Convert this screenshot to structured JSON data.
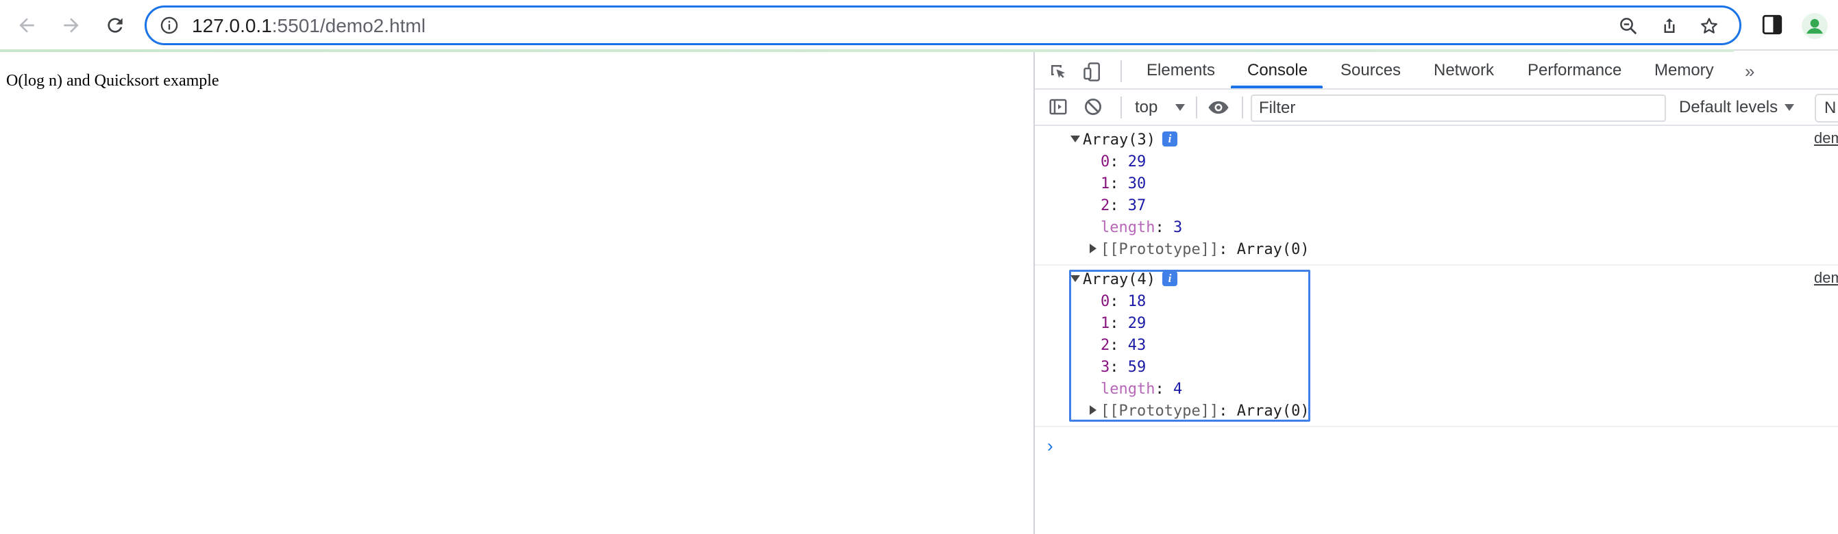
{
  "browser": {
    "url_host": "127.0.0.1",
    "url_rest": ":5501/demo2.html"
  },
  "page": {
    "text": "O(log n) and Quicksort example"
  },
  "devtools": {
    "tabs": [
      {
        "label": "Elements",
        "active": false
      },
      {
        "label": "Console",
        "active": true
      },
      {
        "label": "Sources",
        "active": false
      },
      {
        "label": "Network",
        "active": false
      },
      {
        "label": "Performance",
        "active": false
      },
      {
        "label": "Memory",
        "active": false
      }
    ],
    "more_tabs_glyph": "»",
    "context": "top",
    "filter_placeholder": "Filter",
    "levels": "Default levels",
    "cut_button": "N",
    "accent": "#1a73e8"
  },
  "console": {
    "messages": [
      {
        "source_link": "dem",
        "header": "Array(3)",
        "badge": "i",
        "entries": [
          {
            "key": "0",
            "value": "29"
          },
          {
            "key": "1",
            "value": "30"
          },
          {
            "key": "2",
            "value": "37"
          }
        ],
        "length_key": "length",
        "length_value": "3",
        "proto_key": "[[Prototype]]",
        "proto_value": "Array(0)"
      },
      {
        "source_link": "dem",
        "header": "Array(4)",
        "badge": "i",
        "entries": [
          {
            "key": "0",
            "value": "18"
          },
          {
            "key": "1",
            "value": "29"
          },
          {
            "key": "2",
            "value": "43"
          },
          {
            "key": "3",
            "value": "59"
          }
        ],
        "length_key": "length",
        "length_value": "4",
        "proto_key": "[[Prototype]]",
        "proto_value": "Array(0)"
      }
    ],
    "prompt_glyph": "›"
  }
}
